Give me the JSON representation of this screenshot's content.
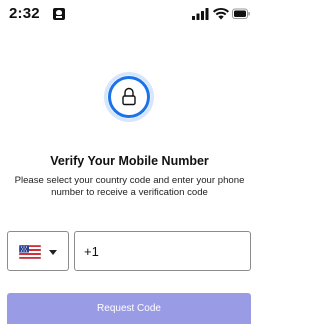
{
  "status_bar": {
    "time": "2:32",
    "id_icon": "person-id-icon",
    "signal_icon": "cellular-signal-icon",
    "wifi_icon": "wifi-icon",
    "battery_icon": "battery-icon"
  },
  "hero": {
    "icon": "lock-icon",
    "accent_color": "#1a73e8",
    "ring_color": "#c7dcfb"
  },
  "title": "Verify Your Mobile Number",
  "subtitle": "Please select your country code and enter your phone number to receive a verification code",
  "country_select": {
    "flag_icon": "us-flag-icon",
    "dropdown_icon": "chevron-down-icon"
  },
  "phone_input": {
    "value": "+1"
  },
  "request_button": {
    "label": "Request Code",
    "background": "#9a9be5",
    "state": "disabled"
  }
}
